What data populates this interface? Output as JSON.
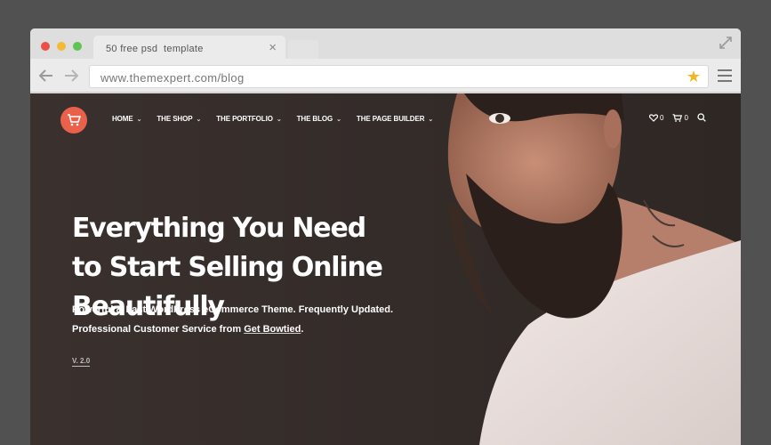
{
  "browser": {
    "tab_title": "50 free psd  template",
    "tab_close": "×",
    "url": "www.themexpert.com/blog",
    "bookmark_star": "★",
    "icons": [
      "close-window-dot",
      "minimize-window-dot",
      "zoom-window-dot",
      "expand-icon",
      "back-arrow-icon",
      "forward-arrow-icon",
      "star-icon",
      "hamburger-menu-icon"
    ],
    "colors": {
      "close": "#ea5048",
      "minimize": "#f3bb35",
      "zoom": "#5fc453",
      "star": "#f2b728"
    }
  },
  "site": {
    "logo_icon": "cart-icon",
    "accent": "#e9604b",
    "nav": [
      {
        "label": "HOME"
      },
      {
        "label": "THE SHOP"
      },
      {
        "label": "THE PORTFOLIO"
      },
      {
        "label": "THE BLOG"
      },
      {
        "label": "THE PAGE BUILDER"
      }
    ],
    "caret": "⌄",
    "wishlist_count": "0",
    "cart_count": "0",
    "hero": {
      "line1": "Everything You Need",
      "line2": "to Start Selling Online Beautifully",
      "sub_line1": "Powerful & Fast WordPress eCommerce Theme. Frequently Updated.",
      "sub_line2_prefix": "Professional Customer Service from ",
      "sub_line2_link": "Get Bowtied",
      "sub_line2_suffix": ".",
      "version": "V. 2.0"
    }
  }
}
